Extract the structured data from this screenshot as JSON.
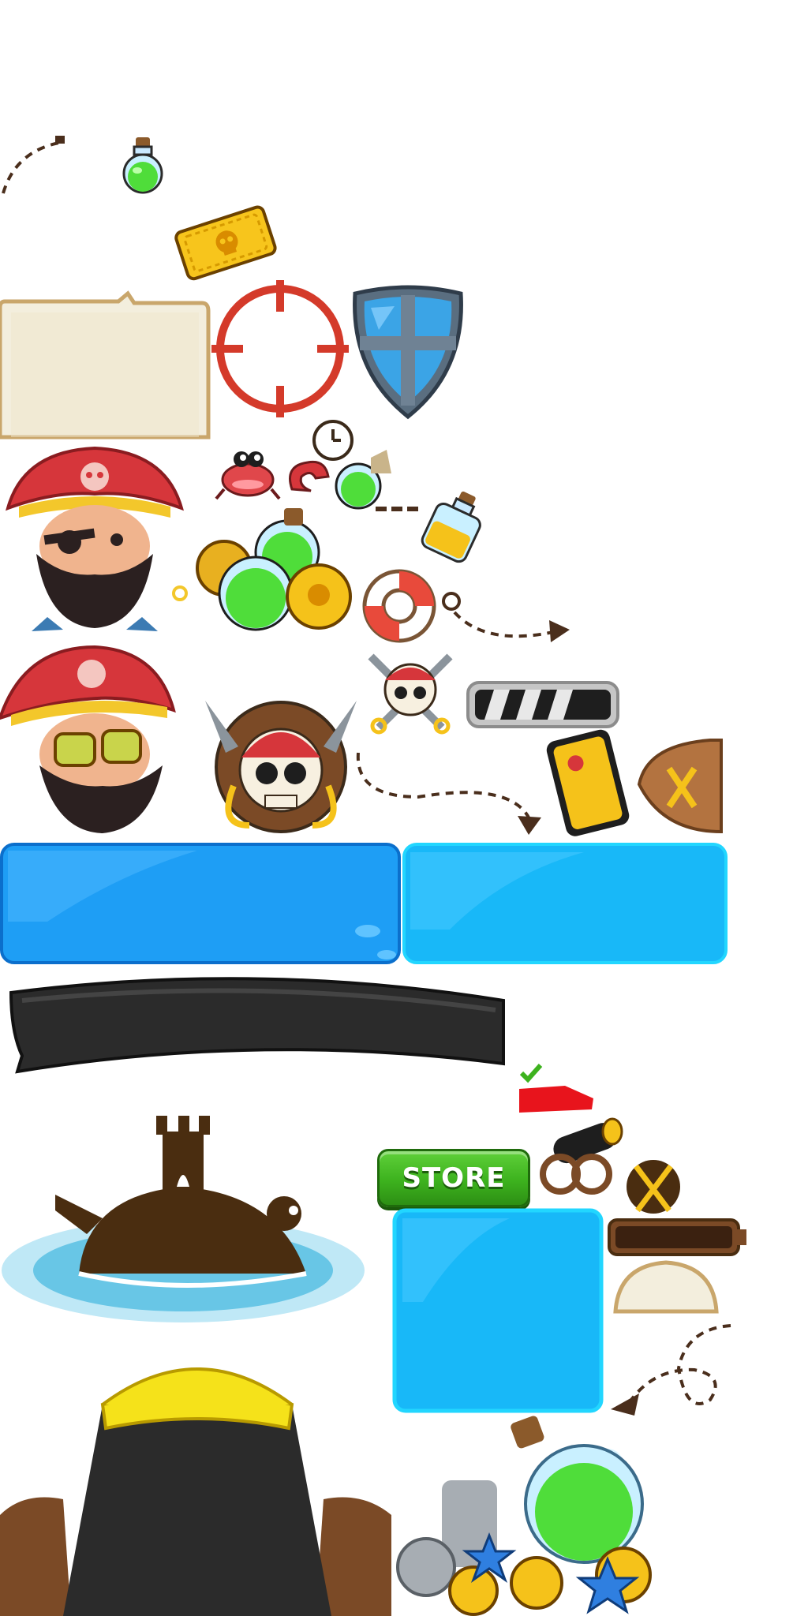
{
  "store_button": {
    "label": "STORE"
  },
  "palette": {
    "blue_panel": "#1e9ef5",
    "cyan_panel": "#18b8f8",
    "pirate_red": "#d6363b",
    "beard": "#2b2020",
    "gold": "#f5c21a",
    "wood": "#7b4a26",
    "parchment": "#f3eedd",
    "potion_green": "#4fdd3a",
    "shield_blue": "#3ba4e6",
    "store_green": "#3db21e"
  },
  "sprites": [
    "dashed-arrow-icon",
    "green-potion-icon",
    "gold-ticket-icon",
    "parchment-panel",
    "crosshair-icon",
    "shield-icon",
    "pirate-captain",
    "crab-icon",
    "clock-icon",
    "rewards-pile-icon",
    "yellow-potion-icon",
    "life-ring-icon",
    "skull-badge-icon",
    "skull-crossed-swords-icon",
    "progress-bar-icon",
    "phone-card-icon",
    "wooden-sign-icon",
    "blue-panel",
    "cyan-panel",
    "black-ribbon-banner",
    "checkmark-icon",
    "red-flag-icon",
    "island-silhouette",
    "cannon-icon",
    "swords-badge-icon",
    "cyan-square-panel",
    "wood-bar-icon",
    "parchment-tab",
    "cannon-closeup",
    "treasure-pile-icon"
  ]
}
